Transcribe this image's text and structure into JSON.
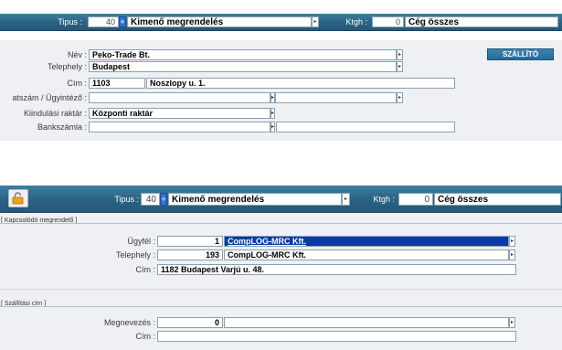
{
  "top": {
    "header": {
      "tipus_label": "Tipus :",
      "tipus_num": "40",
      "tipus_value": "Kimenő megrendelés",
      "ktgh_label": "Ktgh :",
      "ktgh_num": "0",
      "ktgh_value": "Cég összes"
    },
    "form": {
      "nev_label": "Név :",
      "nev_value": "Peko-Trade Bt.",
      "telephely_label": "Telephely :",
      "telephely_value": "Budapest",
      "cim_label": "Cím :",
      "cim_zip": "1103",
      "cim_street": "Noszlopy u. 1.",
      "kapcsolat_label": "atszám / Ügyintéző :",
      "kapcsolat_value1": "",
      "kapcsolat_value2": "",
      "raktar_label": "Kiindulási raktár :",
      "raktar_value": "Központi raktár",
      "bank_label": "Bankszámla :",
      "bank_value1": "",
      "bank_value2": "",
      "szallito_button": "SZÁLLÍTÓ"
    }
  },
  "bottom": {
    "header": {
      "tipus_label": "Tipus :",
      "tipus_num": "40",
      "tipus_value": "Kimenő megrendelés",
      "ktgh_label": "Ktgh :",
      "ktgh_num": "0",
      "ktgh_value": "Cég összes"
    },
    "kapcsolodo": {
      "title": "[ Kapcsolódó megrendelő ]",
      "ugyfel_label": "Ügyfél :",
      "ugyfel_num": "1",
      "ugyfel_value": "CompLOG-MRC Kft.",
      "telephely_label": "Telephely :",
      "telephely_num": "193",
      "telephely_value": "CompLOG-MRC Kft.",
      "cim_label": "Cím :",
      "cim_value": "1182 Budapest Varjú u. 48."
    },
    "szallitasi": {
      "title": "[ Szállítási cím ]",
      "megnevezes_label": "Megnevezés :",
      "megnevezes_num": "0",
      "megnevezes_value": "",
      "cim_label": "Cím :",
      "cim_value": ""
    }
  },
  "icons": {
    "arrow": "▸",
    "plus": "+",
    "lock": "lock-icon"
  },
  "colors": {
    "header": "#2a6283",
    "selection": "#0a3aa6",
    "panel": "#eef0f3"
  }
}
